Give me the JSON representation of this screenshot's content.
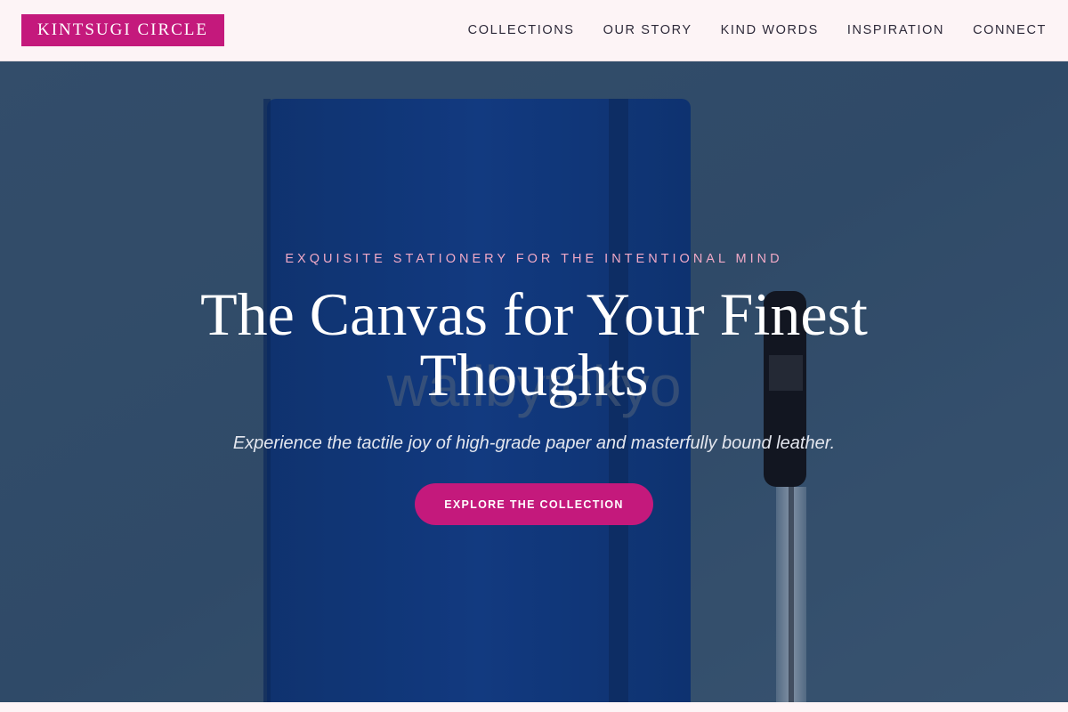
{
  "brand": {
    "name": "KINTSUGI CIRCLE"
  },
  "nav": {
    "items": [
      {
        "label": "COLLECTIONS"
      },
      {
        "label": "OUR STORY"
      },
      {
        "label": "KIND WORDS"
      },
      {
        "label": "INSPIRATION"
      },
      {
        "label": "CONNECT"
      }
    ]
  },
  "hero": {
    "eyebrow": "EXQUISITE STATIONERY FOR THE INTENTIONAL MIND",
    "headline": "The Canvas for Your Finest Thoughts",
    "subtitle": "Experience the tactile joy of high-grade paper and masterfully bound leather.",
    "cta_label": "EXPLORE THE COLLECTION",
    "background_watermark": "wallbytokyo"
  },
  "colors": {
    "accent": "#c4197c",
    "nav_background": "#fdf4f6",
    "eyebrow_text": "#f0a9c6",
    "notebook_blue": "#0f3f8c",
    "backdrop": "#3a5a78"
  }
}
